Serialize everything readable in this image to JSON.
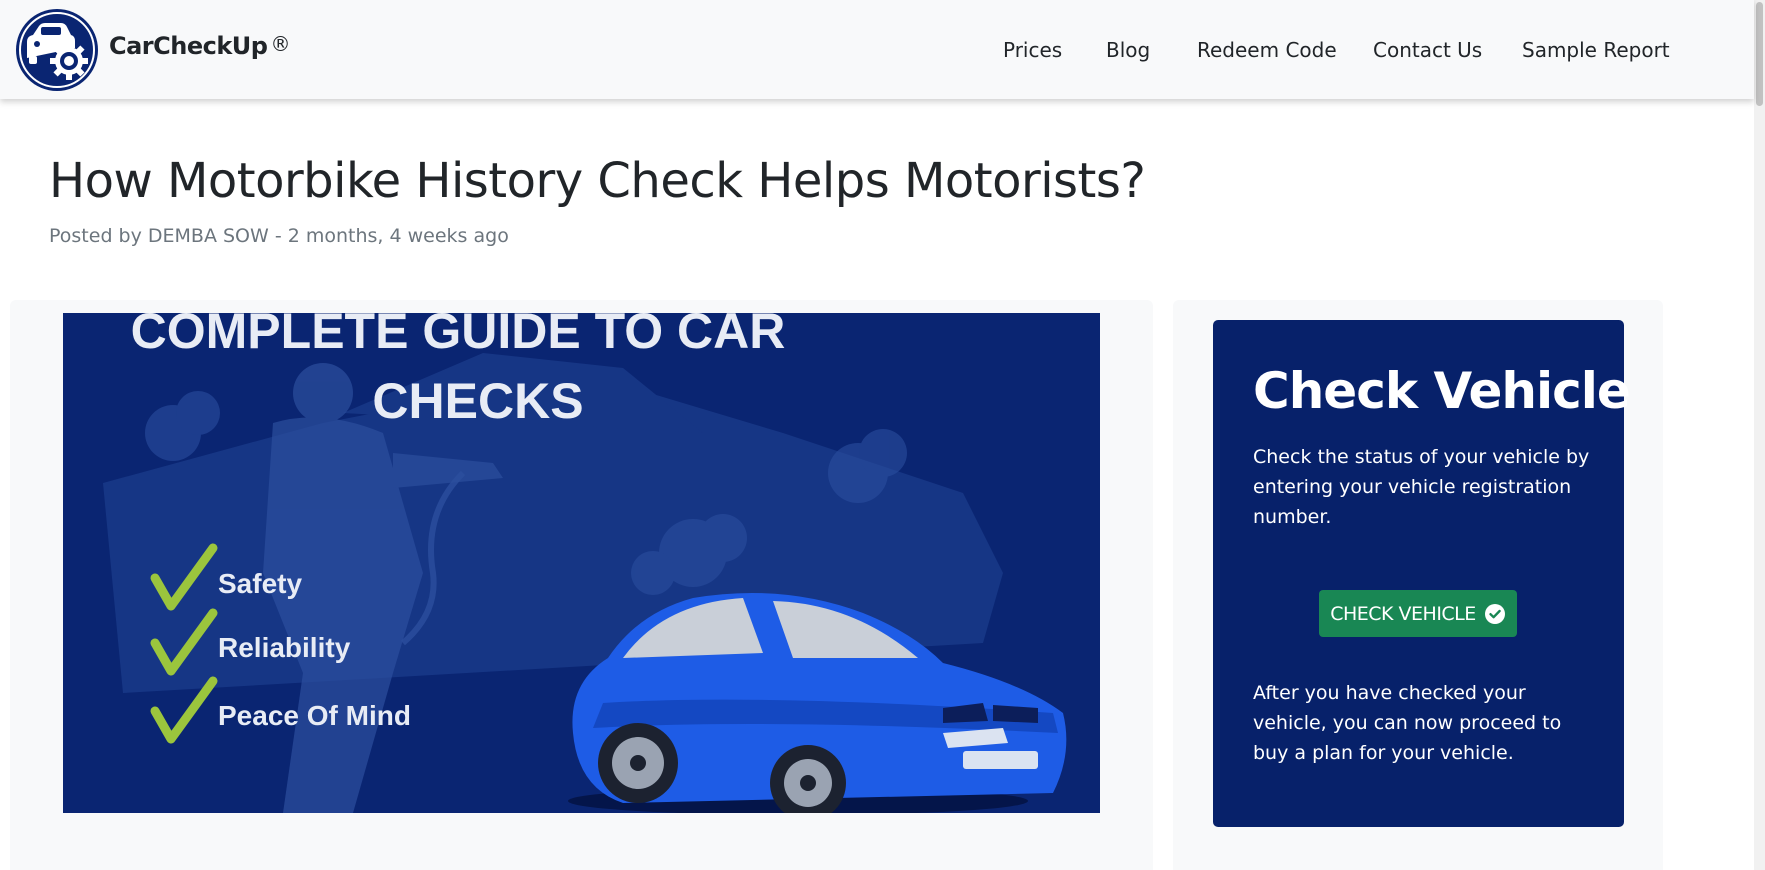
{
  "brand": {
    "name": "CarCheckUp",
    "registered": "®",
    "logo_icon": "car-gear-logo-icon"
  },
  "nav": {
    "items": [
      {
        "label": "Prices"
      },
      {
        "label": "Blog"
      },
      {
        "label": "Redeem Code"
      },
      {
        "label": "Contact Us"
      },
      {
        "label": "Sample Report"
      }
    ]
  },
  "post": {
    "title": "How Motorbike History Check Helps Motorists?",
    "meta": "Posted by DEMBA SOW - 2 months, 4 weeks ago"
  },
  "hero": {
    "headline_line1": "COMPLETE GUIDE TO CAR",
    "headline_line2": "CHECKS",
    "checklist": [
      "Safety",
      "Reliability",
      "Peace Of Mind"
    ]
  },
  "sidebar": {
    "title": "Check Vehicle",
    "description": "Check the status of your vehicle by entering your vehicle registration number.",
    "button_label": "CHECK VEHICLE",
    "button_icon": "check-circle-icon",
    "after_text": "After you have checked your vehicle, you can now proceed to buy a plan for your vehicle."
  },
  "colors": {
    "navbar_bg": "#f8f9fa",
    "brand_blue": "#0a2572",
    "sidebar_box": "#07216a",
    "button_green": "#198754",
    "check_green": "#9bc53d",
    "car_blue": "#1e5ce6"
  }
}
